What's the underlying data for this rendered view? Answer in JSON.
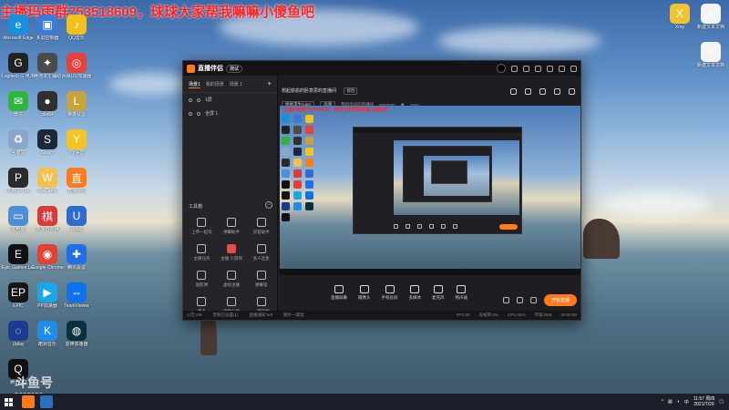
{
  "overlay": {
    "text": "主播玛雨群753518609，球球大家帮我嘛嘛小傻鱼吧"
  },
  "watermark": {
    "line1": "斗鱼号",
    "line2": "5683880"
  },
  "desktop": {
    "left_icons": [
      {
        "label": "Microsoft Edge",
        "color": "#1a8fdd",
        "glyph": "e"
      },
      {
        "label": "多屏控制器",
        "color": "#3a7ad8",
        "glyph": "▣"
      },
      {
        "label": "QQ音乐",
        "color": "#f3c21a",
        "glyph": "♪"
      },
      {
        "label": "Logitech G HUB",
        "color": "#222222",
        "glyph": "G"
      },
      {
        "label": "绝地求生辅助",
        "color": "#4b4b4b",
        "glyph": "✦"
      },
      {
        "label": "网易UU加速器",
        "color": "#e8403a",
        "glyph": "◎"
      },
      {
        "label": "微信",
        "color": "#2fb43e",
        "glyph": "✉"
      },
      {
        "label": "obs64",
        "color": "#303030",
        "glyph": "●"
      },
      {
        "label": "英雄联盟",
        "color": "#c8a23d",
        "glyph": "L"
      },
      {
        "label": "回收站",
        "color": "#8aa7c9",
        "glyph": "♻"
      },
      {
        "label": "Steam",
        "color": "#1b2838",
        "glyph": "S"
      },
      {
        "label": "YY语音",
        "color": "#f6c324",
        "glyph": "Y"
      },
      {
        "label": "PUBG LITE",
        "color": "#2b2b2b",
        "glyph": "P"
      },
      {
        "label": "WeGame",
        "color": "#f2c14e",
        "glyph": "W"
      },
      {
        "label": "直播伴侣",
        "color": "#ff7a1a",
        "glyph": "直"
      },
      {
        "label": "此电脑",
        "color": "#4d8fd6",
        "glyph": "▭"
      },
      {
        "label": "多多自走棋",
        "color": "#d93b3b",
        "glyph": "棋"
      },
      {
        "label": "Uplay",
        "color": "#2f6bd1",
        "glyph": "U"
      },
      {
        "label": "Epic Games Launcher",
        "color": "#111111",
        "glyph": "E"
      },
      {
        "label": "Google Chrome",
        "color": "#e34133",
        "glyph": "◉"
      },
      {
        "label": "腾讯会议",
        "color": "#1e6fe8",
        "glyph": "✚"
      },
      {
        "label": "EPIC",
        "color": "#161616",
        "glyph": "EP"
      },
      {
        "label": "PP加速器",
        "color": "#1aa6e8",
        "glyph": "▶"
      },
      {
        "label": "TeamViewer",
        "color": "#0e72ed",
        "glyph": "⇔"
      },
      {
        "label": "Uplay",
        "color": "#1a3c8f",
        "glyph": "◌"
      },
      {
        "label": "酷狗音乐",
        "color": "#1d8de8",
        "glyph": "K"
      },
      {
        "label": "雷神加速器",
        "color": "#0d3040",
        "glyph": "◍"
      },
      {
        "label": "腾讯QQ",
        "color": "#111111",
        "glyph": "Q"
      }
    ],
    "right_icons": [
      {
        "label": "Xmp",
        "color": "#f1c232",
        "glyph": "X"
      },
      {
        "label": "新建文本文档",
        "color": "#f4f4f4",
        "glyph": "≡"
      },
      {
        "label": "新建文本文档",
        "color": "#f4f4f4",
        "glyph": "≡"
      }
    ]
  },
  "app": {
    "name": "直播伴侣",
    "version_badge": "测试",
    "scene_tabs": [
      "场景1",
      "我的场景",
      "场景 1"
    ],
    "sources": [
      "1屏",
      "全屏 1"
    ],
    "tools_title": "工具箱",
    "tools": [
      {
        "label": "上传一起玩",
        "hot": false
      },
      {
        "label": "弹幕助手",
        "hot": false
      },
      {
        "label": "房管助手",
        "hot": false
      },
      {
        "label": "主播任务",
        "hot": false
      },
      {
        "label": "主播 小游戏",
        "hot": true
      },
      {
        "label": "多人连麦",
        "hot": false
      },
      {
        "label": "观影弹",
        "hot": false
      },
      {
        "label": "虚拟主播",
        "hot": false
      },
      {
        "label": "弹幕墙",
        "hot": false
      },
      {
        "label": "更多",
        "hot": false
      },
      {
        "label": "视频分享",
        "hot": false
      },
      {
        "label": "一键美颜",
        "hot": false
      }
    ],
    "stream": {
      "title": "想起偷偷的卧意思的直播间",
      "edit_label": "修改",
      "category": "绝地求生(Lite)",
      "quality": "高清",
      "room_label": "我的房间的直播间",
      "room_id": "8583880",
      "heat": "1550"
    },
    "preview_text": "主播玛雨群753518609，球球大家帮我嘛嘛小傻鱼吧",
    "bottom_tools": [
      "直播屏幕",
      "摄像头",
      "手机投屏",
      "多媒体",
      "麦克风",
      "扬声器"
    ],
    "start_label": "开始直播",
    "status": {
      "left": [
        "公告:0/8",
        "音频已设置(1)",
        "直播通知:0/0",
        "图片一键滤"
      ],
      "right": [
        "FPS:30",
        "丢帧率:0%",
        "CPU:45%",
        "带宽:0KB",
        "00:00:00"
      ]
    }
  },
  "taskbar": {
    "time": "11:57 周四",
    "date": "2021/7/29",
    "lang": "中"
  }
}
